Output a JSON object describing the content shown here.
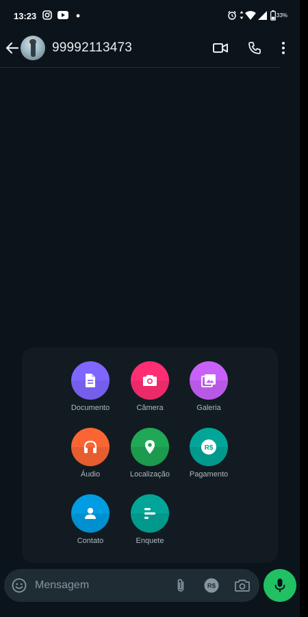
{
  "status_bar": {
    "time": "13:23",
    "battery": "33%"
  },
  "header": {
    "contact_name": "99992113473"
  },
  "attach_menu": {
    "options": [
      {
        "label": "Documento",
        "color": "#7f66ff"
      },
      {
        "label": "Câmera",
        "color": "#ff2e74"
      },
      {
        "label": "Galeria",
        "color": "#c861fa"
      },
      {
        "label": "Áudio",
        "color": "#fa6533"
      },
      {
        "label": "Localização",
        "color": "#1fa855"
      },
      {
        "label": "Pagamento",
        "color": "#02a698"
      },
      {
        "label": "Contato",
        "color": "#009de2"
      },
      {
        "label": "Enquete",
        "color": "#02a698"
      }
    ]
  },
  "composer": {
    "placeholder": "Mensagem",
    "payment_glyph": "R$"
  },
  "colors": {
    "background": "#0b141a",
    "panel": "#1f2c33",
    "accent": "#21c063"
  }
}
